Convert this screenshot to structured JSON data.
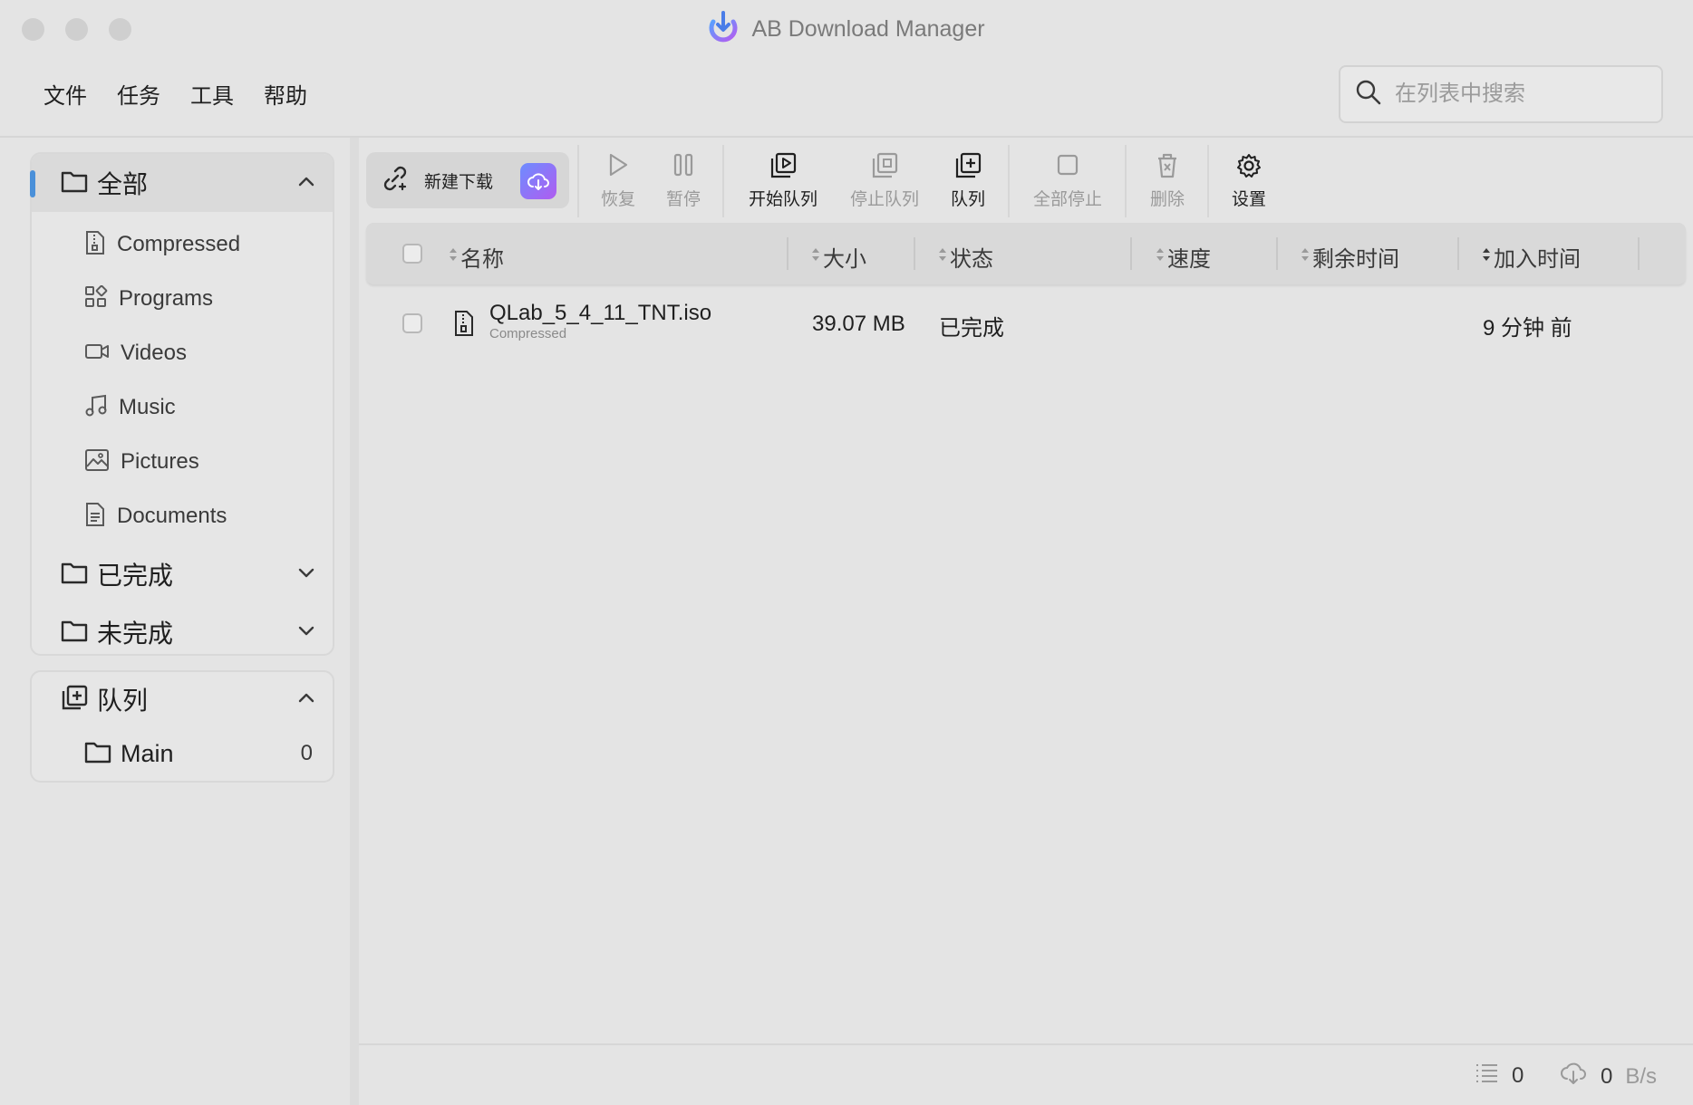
{
  "window": {
    "title": "AB Download Manager"
  },
  "menu": [
    "文件",
    "任务",
    "工具",
    "帮助"
  ],
  "search": {
    "placeholder": "在列表中搜索"
  },
  "sidebar": {
    "all": {
      "label": "全部"
    },
    "categories": [
      {
        "label": "Compressed",
        "icon": "zip-file-icon"
      },
      {
        "label": "Programs",
        "icon": "apps-grid-icon"
      },
      {
        "label": "Videos",
        "icon": "video-camera-icon"
      },
      {
        "label": "Music",
        "icon": "music-note-icon"
      },
      {
        "label": "Pictures",
        "icon": "image-icon"
      },
      {
        "label": "Documents",
        "icon": "document-icon"
      }
    ],
    "finished": {
      "label": "已完成"
    },
    "unfinished": {
      "label": "未完成"
    },
    "queues": {
      "label": "队列",
      "items": [
        {
          "label": "Main",
          "count": "0"
        }
      ]
    }
  },
  "toolbar": {
    "new_download": "新建下载",
    "resume": "恢复",
    "pause": "暂停",
    "start_queue": "开始队列",
    "stop_queue": "停止队列",
    "queue": "队列",
    "stop_all": "全部停止",
    "delete": "删除",
    "settings": "设置"
  },
  "table": {
    "columns": {
      "name": "名称",
      "size": "大小",
      "status": "状态",
      "speed": "速度",
      "remaining": "剩余时间",
      "added": "加入时间"
    },
    "rows": [
      {
        "name": "QLab_5_4_11_TNT.iso",
        "category": "Compressed",
        "size": "39.07 MB",
        "status": "已完成",
        "speed": "",
        "remaining": "",
        "added": "9 分钟 前"
      }
    ]
  },
  "statusbar": {
    "active_count": "0",
    "speed_value": "0",
    "speed_unit": "B/s"
  },
  "colors": {
    "accent": "#4a90d9",
    "background": "#e4e4e4",
    "new_download_gradient_start": "#6d8dff",
    "new_download_gradient_end": "#b05cf0"
  }
}
